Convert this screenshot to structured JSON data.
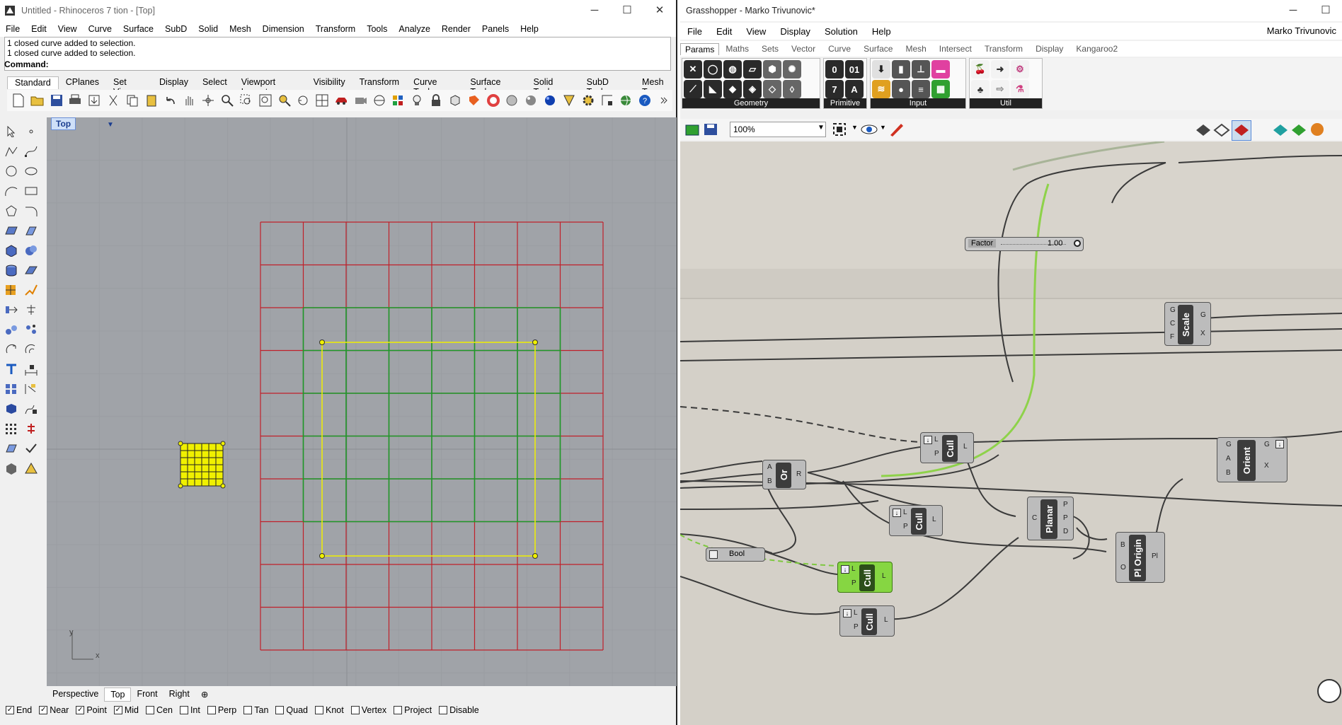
{
  "rhino": {
    "title": "Untitled - Rhinoceros 7 tion - [Top]",
    "window_controls": [
      "─",
      "☐",
      "✕"
    ],
    "menu": [
      "File",
      "Edit",
      "View",
      "Curve",
      "Surface",
      "SubD",
      "Solid",
      "Mesh",
      "Dimension",
      "Transform",
      "Tools",
      "Analyze",
      "Render",
      "Panels",
      "Help"
    ],
    "history": [
      "1 closed curve added to selection.",
      "1 closed curve added to selection."
    ],
    "command_label": "Command:",
    "toolbar_tabs": [
      "Standard",
      "CPlanes",
      "Set View",
      "Display",
      "Select",
      "Viewport Layout",
      "Visibility",
      "Transform",
      "Curve Tools",
      "Surface Tools",
      "Solid Tools",
      "SubD Tools",
      "Mesh T"
    ],
    "viewport_title": "Top",
    "axis_x": "x",
    "axis_y": "y",
    "viewport_tabs": [
      "Perspective",
      "Top",
      "Front",
      "Right"
    ],
    "osnaps": [
      {
        "label": "End",
        "checked": true
      },
      {
        "label": "Near",
        "checked": true
      },
      {
        "label": "Point",
        "checked": true
      },
      {
        "label": "Mid",
        "checked": true
      },
      {
        "label": "Cen",
        "checked": false
      },
      {
        "label": "Int",
        "checked": false
      },
      {
        "label": "Perp",
        "checked": false
      },
      {
        "label": "Tan",
        "checked": false
      },
      {
        "label": "Quad",
        "checked": false
      },
      {
        "label": "Knot",
        "checked": false
      },
      {
        "label": "Vertex",
        "checked": false
      },
      {
        "label": "Project",
        "checked": false
      },
      {
        "label": "Disable",
        "checked": false
      }
    ],
    "colors": {
      "red_grid": "#c0202a",
      "green_grid": "#1c9a2a",
      "selection": "#f0f000",
      "viewport_bg": "#a0a3a8"
    }
  },
  "gh": {
    "title": "Grasshopper - Marko Trivunovic*",
    "user": "Marko Trivunovic",
    "menu": [
      "File",
      "Edit",
      "View",
      "Display",
      "Solution",
      "Help"
    ],
    "tabs": [
      "Params",
      "Maths",
      "Sets",
      "Vector",
      "Curve",
      "Surface",
      "Mesh",
      "Intersect",
      "Transform",
      "Display",
      "Kangaroo2"
    ],
    "groups": [
      "Geometry",
      "Primitive",
      "Input",
      "Util"
    ],
    "zoom": "100%",
    "components": {
      "scale": {
        "name": "Scale",
        "inputs": [
          "G",
          "C",
          "F"
        ],
        "outputs": [
          "G",
          "X"
        ]
      },
      "factor": {
        "label": "Factor",
        "value": "1.00"
      },
      "or": {
        "name": "Or",
        "inputs": [
          "A",
          "B"
        ],
        "outputs": [
          "R"
        ]
      },
      "cull1": {
        "name": "Cull",
        "inputs": [
          "L",
          "P"
        ],
        "outputs": [
          "L"
        ]
      },
      "cull2": {
        "name": "Cull",
        "inputs": [
          "L",
          "P"
        ],
        "outputs": [
          "L"
        ]
      },
      "cull3": {
        "name": "Cull",
        "inputs": [
          "L",
          "P"
        ],
        "outputs": [
          "L"
        ]
      },
      "cull4": {
        "name": "Cull",
        "inputs": [
          "L",
          "P"
        ],
        "outputs": [
          "L"
        ]
      },
      "bool": {
        "label": "Bool"
      },
      "planar": {
        "name": "Planar",
        "inputs": [
          "C"
        ],
        "outputs": [
          "P",
          "P",
          "D"
        ]
      },
      "ploorigin": {
        "name": "Pl Origin",
        "inputs": [
          "B",
          "O"
        ],
        "outputs": [
          "Pl"
        ]
      },
      "orient": {
        "name": "Orient",
        "inputs": [
          "G",
          "A",
          "B"
        ],
        "outputs": [
          "G",
          "X"
        ]
      }
    },
    "colors": {
      "canvas": "#d4d0c8",
      "component": "#bcbcbc",
      "selected": "#7ed23a",
      "wire": "#3a3a3a"
    }
  }
}
